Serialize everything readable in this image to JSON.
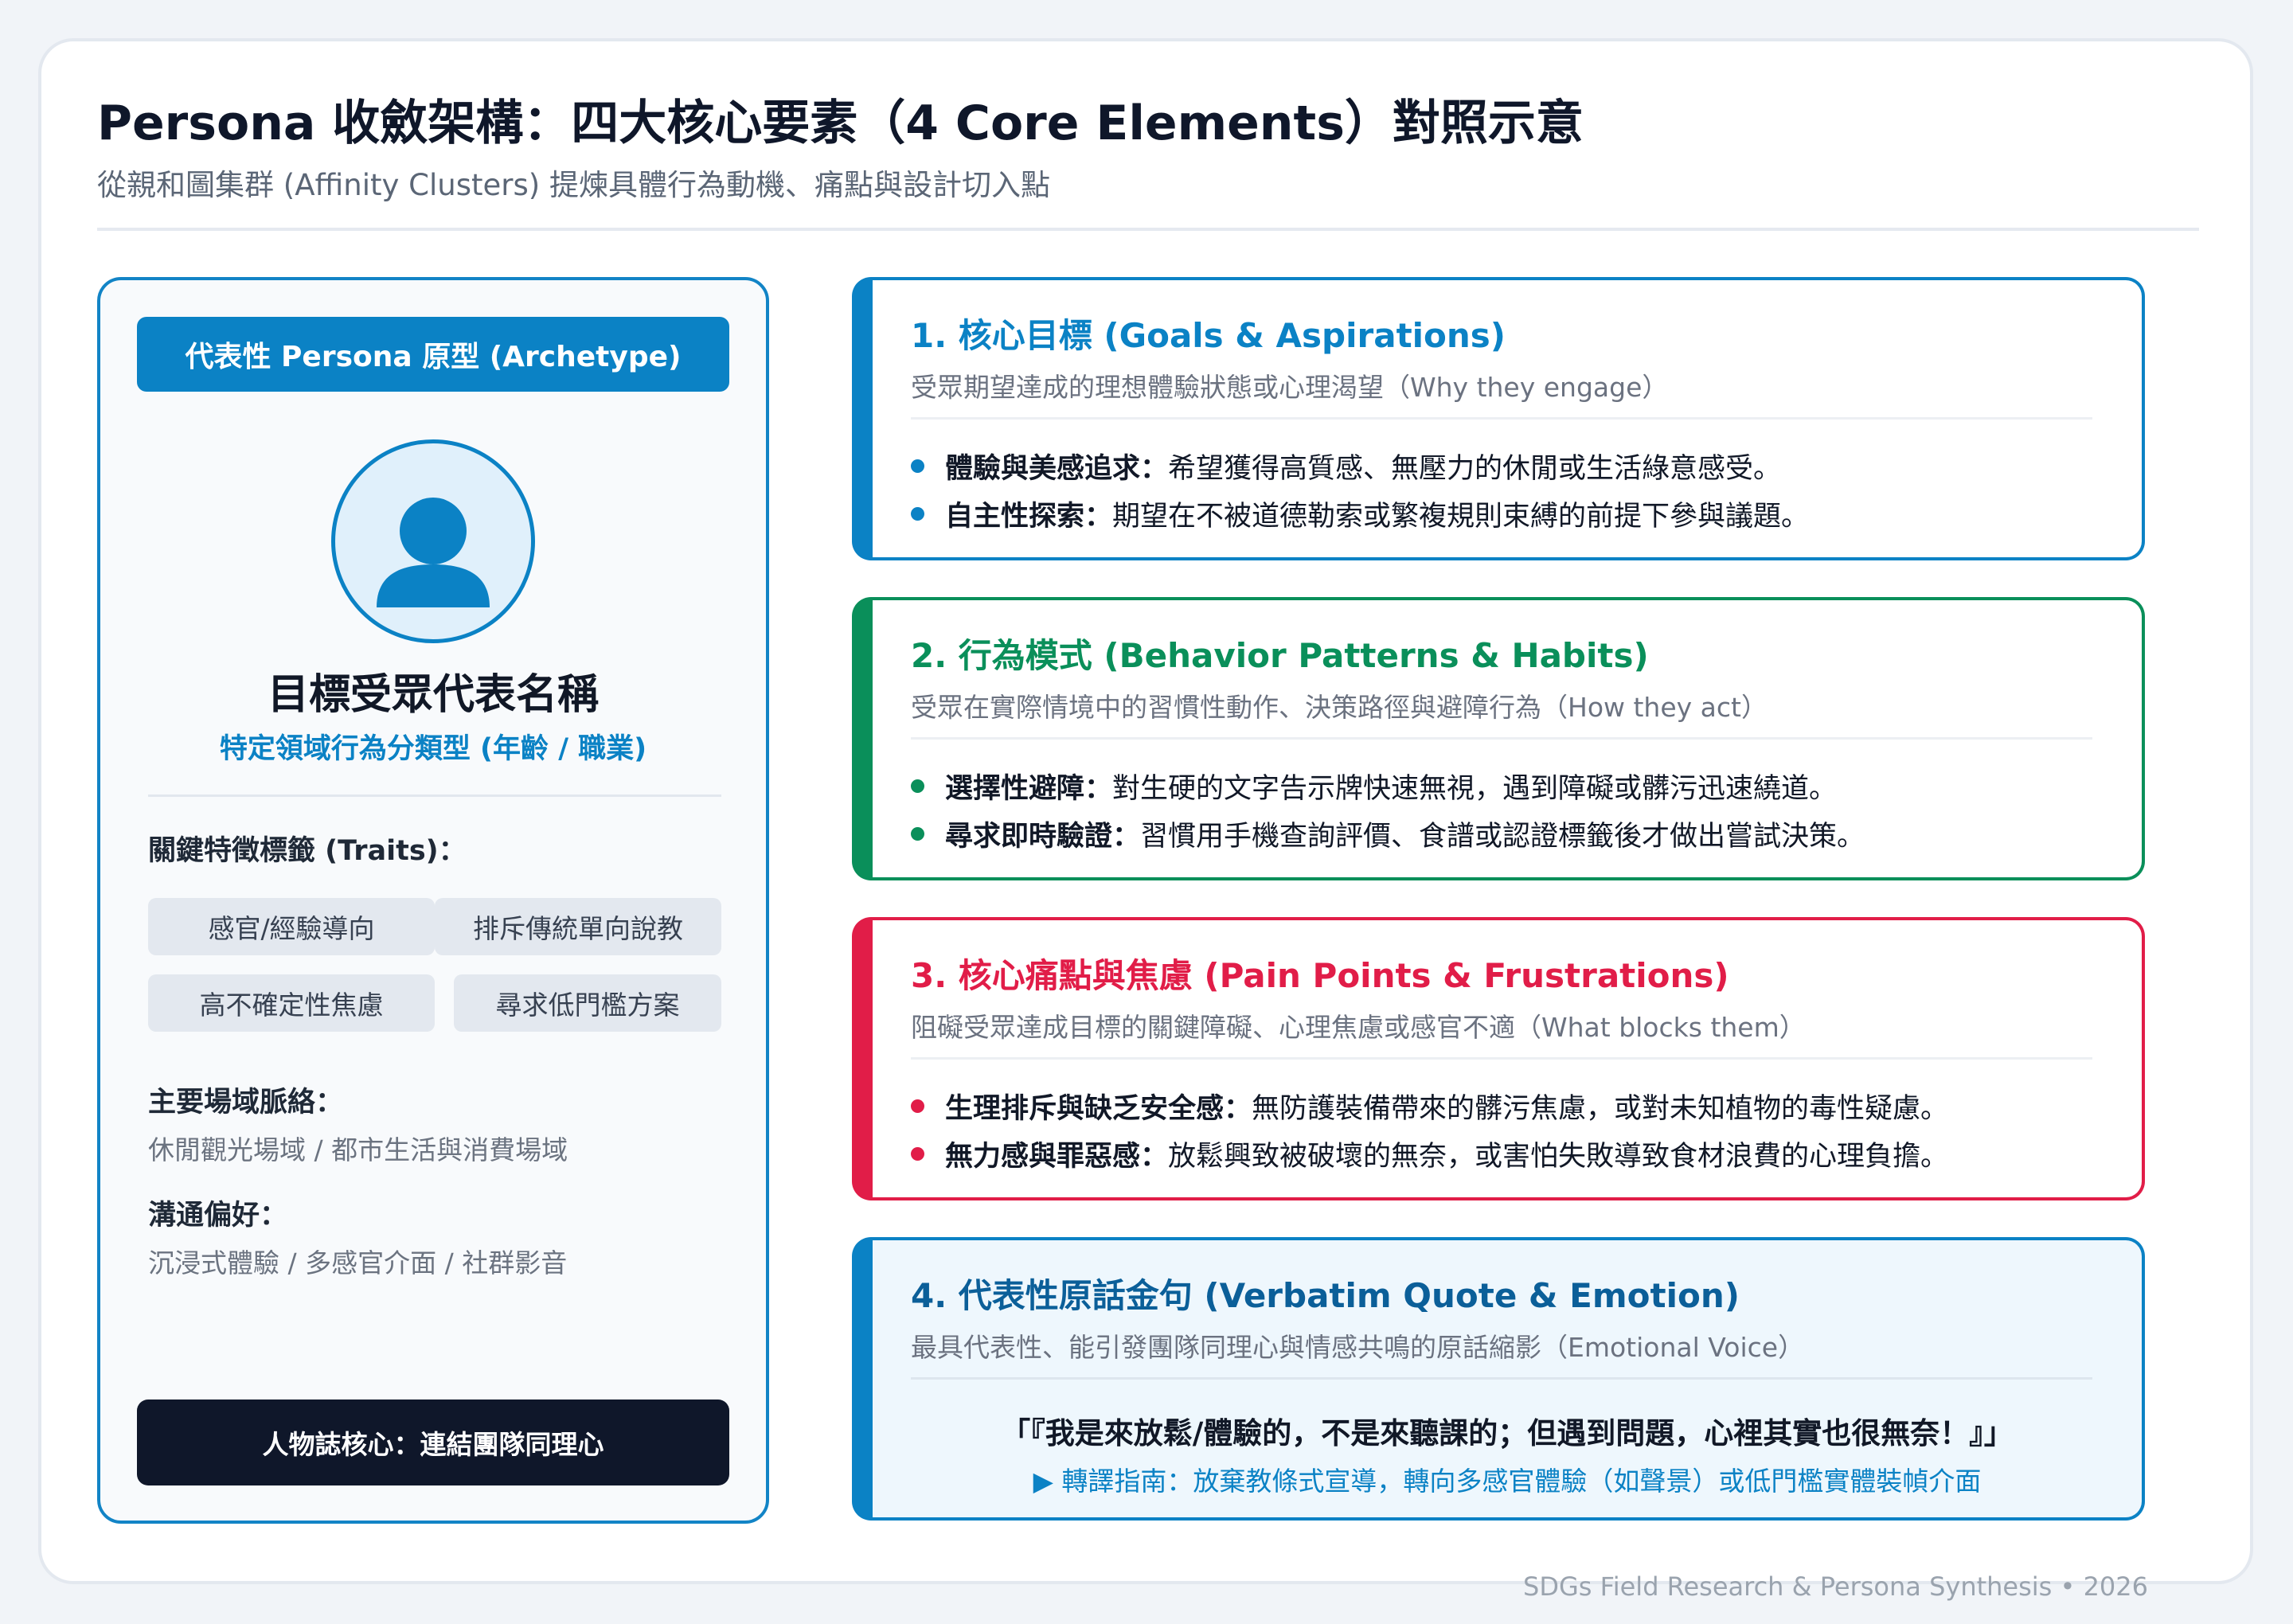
{
  "header": {
    "title": "Persona 收斂架構：四大核心要素（4 Core Elements）對照示意",
    "subtitle": "從親和圖集群 (Affinity Clusters) 提煉具體行為動機、痛點與設計切入點"
  },
  "persona": {
    "banner": "代表性 Persona 原型 (Archetype)",
    "name": "目標受眾代表名稱",
    "type": "特定領域行為分類型 (年齡 / 職業)",
    "traits_label": "關鍵特徵標籤 (Traits)：",
    "traits": [
      "感官/經驗導向",
      "排斥傳統單向說教",
      "高不確定性焦慮",
      "尋求低門檻方案"
    ],
    "context_label": "主要場域脈絡：",
    "context": "休閒觀光場域 / 都市生活與消費場域",
    "channel_label": "溝通偏好：",
    "channel": "沉浸式體驗 / 多感官介面 / 社群影音",
    "footer": "人物誌核心：連結團隊同理心"
  },
  "elements": [
    {
      "title": "1. 核心目標 (Goals & Aspirations)",
      "desc": "受眾期望達成的理想體驗狀態或心理渴望（Why they engage）",
      "color": "#0b82c5",
      "bullets": [
        {
          "label": "體驗與美感追求：",
          "text": "希望獲得高質感、無壓力的休閒或生活綠意感受。"
        },
        {
          "label": "自主性探索：",
          "text": "期望在不被道德勒索或繁複規則束縛的前提下參與議題。"
        }
      ]
    },
    {
      "title": "2. 行為模式 (Behavior Patterns & Habits)",
      "desc": "受眾在實際情境中的習慣性動作、決策路徑與避障行為（How they act）",
      "color": "#0a8f5a",
      "bullets": [
        {
          "label": "選擇性避障：",
          "text": "對生硬的文字告示牌快速無視，遇到障礙或髒污迅速繞道。"
        },
        {
          "label": "尋求即時驗證：",
          "text": "習慣用手機查詢評價、食譜或認證標籤後才做出嘗試決策。"
        }
      ]
    },
    {
      "title": "3. 核心痛點與焦慮 (Pain Points & Frustrations)",
      "desc": "阻礙受眾達成目標的關鍵障礙、心理焦慮或感官不適（What blocks them）",
      "color": "#e11d48",
      "bullets": [
        {
          "label": "生理排斥與缺乏安全感：",
          "text": "無防護裝備帶來的髒污焦慮，或對未知植物的毒性疑慮。"
        },
        {
          "label": "無力感與罪惡感：",
          "text": "放鬆興致被破壞的無奈，或害怕失敗導致食材浪費的心理負擔。"
        }
      ]
    },
    {
      "title": "4. 代表性原話金句 (Verbatim Quote & Emotion)",
      "desc": "最具代表性、能引發團隊同理心與情感共鳴的原話縮影（Emotional Voice）",
      "color": "#0b82c5",
      "quote": "「『我是來放鬆/體驗的，不是來聽課的；但遇到問題，心裡其實也很無奈！』」",
      "guide": "▶ 轉譯指南：放棄教條式宣導，轉向多感官體驗（如聲景）或低門檻實體裝幀介面"
    }
  ],
  "footer": "SDGs Field Research & Persona Synthesis • 2026"
}
